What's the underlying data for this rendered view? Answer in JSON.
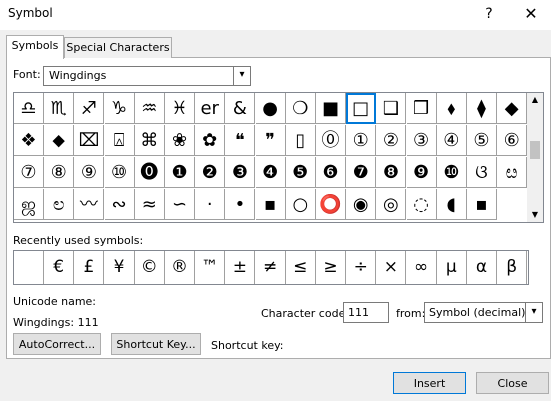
{
  "window": {
    "title": "Symbol",
    "help": "?",
    "close": "✕"
  },
  "tabs": [
    {
      "label": "Symbols"
    },
    {
      "label": "Special Characters"
    }
  ],
  "font": {
    "label": "Font:",
    "value": "Wingdings",
    "arrow": "▾"
  },
  "symbols": [
    "♎",
    "♏",
    "♐",
    "♑",
    "♒",
    "♓",
    "er",
    "&",
    "●",
    "❍",
    "■",
    "□",
    "❑",
    "❒",
    "⬧",
    "⧫",
    "◆",
    "❖",
    "⬥",
    "⌧",
    "⍓",
    "⌘",
    "❀",
    "✿",
    "❝",
    "❞",
    "▯",
    "⓪",
    "①",
    "②",
    "③",
    "④",
    "⑤",
    "⑥",
    "⑦",
    "⑧",
    "⑨",
    "⑩",
    "⓿",
    "❶",
    "❷",
    "❸",
    "❹",
    "❺",
    "❻",
    "❼",
    "❽",
    "❾",
    "❿",
    "ଓ",
    "ೞ",
    "ஜ",
    "ಲ",
    "〰",
    "∾",
    "≈",
    "∽",
    "·",
    "•",
    "▪",
    "○",
    "⭕",
    "◉",
    "◎",
    "◌",
    "◖",
    "▪"
  ],
  "selected_index": 11,
  "scrollbar": {
    "up": "▲",
    "down": "▼"
  },
  "recent": {
    "label": "Recently used symbols:",
    "symbols": [
      "",
      "€",
      "£",
      "¥",
      "©",
      "®",
      "™",
      "±",
      "≠",
      "≤",
      "≥",
      "÷",
      "×",
      "∞",
      "µ",
      "α",
      "β"
    ]
  },
  "unicode": {
    "label": "Unicode name:",
    "value": "Wingdings: 111"
  },
  "charcode": {
    "label": "Character code:",
    "value": "111"
  },
  "from": {
    "label": "from:",
    "value": "Symbol (decimal)",
    "arrow": "▾"
  },
  "buttons": {
    "autocorrect": "AutoCorrect...",
    "shortcut": "Shortcut Key...",
    "shortcut_key_label": "Shortcut key:",
    "insert": "Insert",
    "close": "Close"
  }
}
